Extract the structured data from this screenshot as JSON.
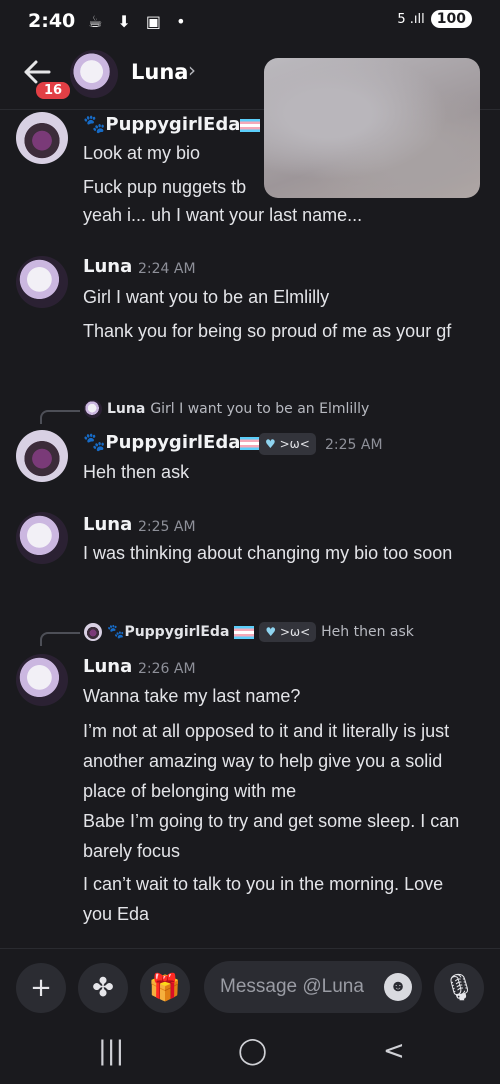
{
  "status": {
    "time": "2:40",
    "icons": "☕ ⬇ ▣ •",
    "signal": "5 .ıll",
    "battery": "100"
  },
  "header": {
    "unread": "16",
    "name": "Luna",
    "chevron": "›"
  },
  "messages": [
    {
      "author": "PuppygirlEda",
      "lines": [
        "Look at my bio",
        "Fuck pup nuggets tb",
        "yeah i... uh I want your last name..."
      ]
    },
    {
      "author": "Luna",
      "time": "2:24 AM",
      "lines": [
        "Girl I want you to be an Elmlilly",
        "Thank you for being so proud of me as your gf"
      ]
    },
    {
      "reply_author": "Luna",
      "reply_text": "Girl I want you to be an Elmlilly",
      "author": "PuppygirlEda",
      "tag": ">ω<",
      "time": "2:25 AM",
      "lines": [
        "Heh then ask"
      ]
    },
    {
      "author": "Luna",
      "time": "2:25 AM",
      "lines": [
        "I was thinking about changing my bio too soon"
      ]
    },
    {
      "reply_author": "PuppygirlEda",
      "reply_tag": ">ω<",
      "reply_text": "Heh then ask",
      "author": "Luna",
      "time": "2:26 AM",
      "lines": [
        "Wanna take my last name?",
        "I’m not at all opposed to it and it literally is just another amazing way to help give you a solid place of belonging with me",
        "Babe I’m going to try and get some sleep. I can barely focus",
        "I can’t wait to talk to you in the morning. Love you Eda"
      ]
    }
  ],
  "composer": {
    "placeholder": "Message @Luna",
    "add": "+",
    "apps": "✤",
    "gift": "🎁",
    "emoji": "☻",
    "mic": "🎙"
  },
  "navbar": {
    "recents": "|||",
    "home": "◯",
    "back": "<"
  },
  "colors": {
    "background": "#1a1a1e",
    "badge": "#e23f45",
    "input": "#2b2c32"
  }
}
